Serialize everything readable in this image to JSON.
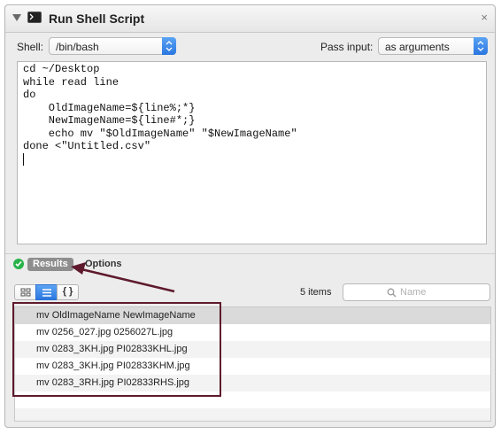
{
  "action": {
    "title": "Run Shell Script",
    "close_label": "×"
  },
  "shell": {
    "label": "Shell:",
    "value": "/bin/bash"
  },
  "pass_input": {
    "label": "Pass input:",
    "value": "as arguments"
  },
  "script": {
    "lines": [
      "cd ~/Desktop",
      "while read line",
      "do",
      "    OldImageName=${line%;*}",
      "    NewImageName=${line#*;}",
      "    echo mv \"$OldImageName\" \"$NewImageName\"",
      "done <\"Untitled.csv\""
    ]
  },
  "tabs": {
    "results": "Results",
    "options": "Options"
  },
  "results": {
    "count_label": "5 items",
    "search_placeholder": "Name",
    "rows": [
      "mv OldImageName NewImageName",
      "mv 0256_027.jpg 0256027L.jpg",
      "mv 0283_3KH.jpg PI02833KHL.jpg",
      "mv 0283_3KH.jpg PI02833KHM.jpg",
      "mv 0283_3RH.jpg PI02833RHS.jpg"
    ]
  },
  "colors": {
    "annotation": "#5e1a2c",
    "accent": "#2a77e0",
    "success": "#28b24a"
  }
}
